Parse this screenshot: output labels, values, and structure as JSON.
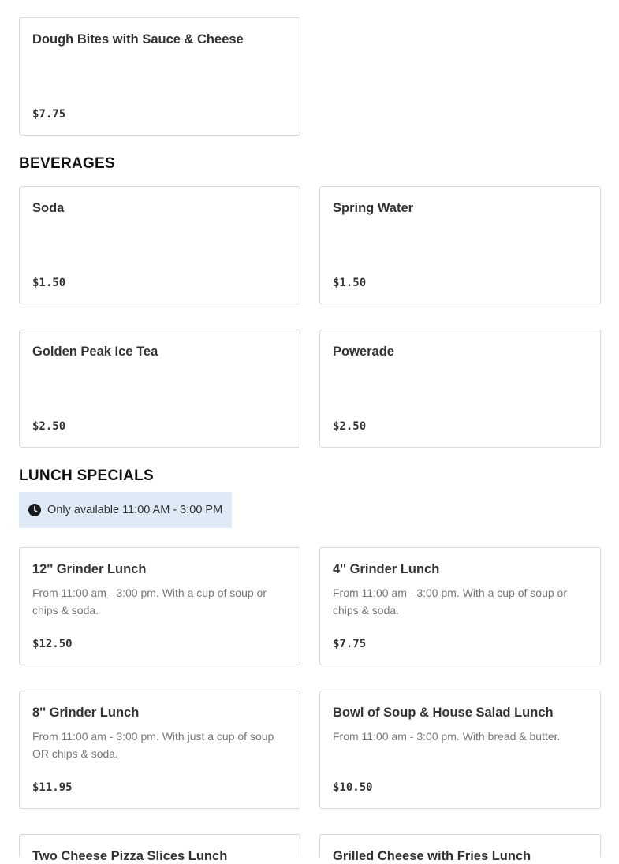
{
  "sections": {
    "beverages": "BEVERAGES",
    "lunch_specials": "LUNCH SPECIALS"
  },
  "notice": {
    "icon": "clock-icon",
    "text": "Only available 11:00 AM - 3:00 PM"
  },
  "items": {
    "dough_bites": {
      "name": "Dough Bites with Sauce & Cheese",
      "price": "$7.75"
    },
    "soda": {
      "name": "Soda",
      "price": "$1.50"
    },
    "spring_water": {
      "name": "Spring Water",
      "price": "$1.50"
    },
    "ice_tea": {
      "name": "Golden Peak Ice Tea",
      "price": "$2.50"
    },
    "powerade": {
      "name": "Powerade",
      "price": "$2.50"
    },
    "grinder12": {
      "name": "12'' Grinder Lunch",
      "desc": "From 11:00 am - 3:00 pm. With a cup of soup or chips & soda.",
      "price": "$12.50"
    },
    "grinder4": {
      "name": "4'' Grinder Lunch",
      "desc": "From 11:00 am - 3:00 pm. With a cup of soup or chips & soda.",
      "price": "$7.75"
    },
    "grinder8": {
      "name": "8'' Grinder Lunch",
      "desc": "From 11:00 am - 3:00 pm. With just a cup of soup OR chips & soda.",
      "price": "$11.95"
    },
    "soup_salad": {
      "name": "Bowl of Soup & House Salad Lunch",
      "desc": "From 11:00 am - 3:00 pm. With bread & butter.",
      "price": "$10.50"
    },
    "pizza_slices": {
      "name": "Two Cheese Pizza Slices Lunch"
    },
    "grilled_cheese": {
      "name": "Grilled Cheese with Fries Lunch"
    }
  }
}
